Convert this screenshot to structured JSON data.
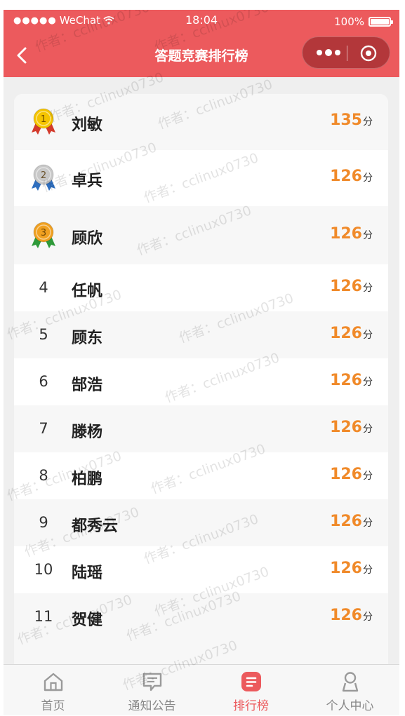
{
  "status_bar": {
    "carrier": "WeChat",
    "time": "18:04",
    "battery": "100%",
    "battery_level": 1.0
  },
  "nav": {
    "title": "答题竞赛排行榜"
  },
  "leaderboard": {
    "unit": "分",
    "rows": [
      {
        "rank": "1",
        "name": "刘敏",
        "score": "135",
        "medal": "gold"
      },
      {
        "rank": "2",
        "name": "卓兵",
        "score": "126",
        "medal": "silver"
      },
      {
        "rank": "3",
        "name": "顾欣",
        "score": "126",
        "medal": "bronze"
      },
      {
        "rank": "4",
        "name": "任帆",
        "score": "126"
      },
      {
        "rank": "5",
        "name": "顾东",
        "score": "126"
      },
      {
        "rank": "6",
        "name": "郜浩",
        "score": "126"
      },
      {
        "rank": "7",
        "name": "滕杨",
        "score": "126"
      },
      {
        "rank": "8",
        "name": "柏鹏",
        "score": "126"
      },
      {
        "rank": "9",
        "name": "都秀云",
        "score": "126"
      },
      {
        "rank": "10",
        "name": "陆瑶",
        "score": "126"
      },
      {
        "rank": "11",
        "name": "贺健",
        "score": "126"
      }
    ]
  },
  "tabbar": {
    "tabs": [
      {
        "label": "首页",
        "icon": "home-icon"
      },
      {
        "label": "通知公告",
        "icon": "message-icon"
      },
      {
        "label": "排行榜",
        "icon": "ranking-icon",
        "active": true
      },
      {
        "label": "个人中心",
        "icon": "user-icon"
      }
    ]
  },
  "watermark": "作者：cclinux0730",
  "colors": {
    "brand": "#ec5a5d",
    "score": "#f08a2a",
    "gold": "#f5c400",
    "silver": "#c8c8c8",
    "bronze": "#f0a020"
  }
}
